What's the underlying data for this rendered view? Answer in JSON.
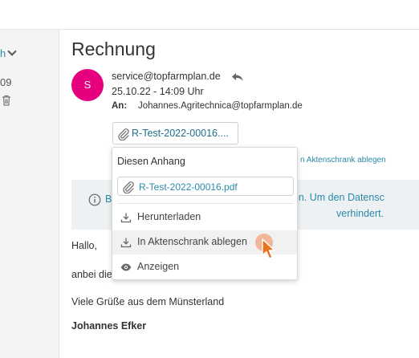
{
  "left_pane": {
    "sort_label": "h",
    "date_fragment": "09"
  },
  "email": {
    "subject": "Rechnung",
    "avatar_initial": "S",
    "sender": "service@topfarmplan.de",
    "date": "25.10.22 - 14:09 Uhr",
    "to_label": "An:",
    "to_value": "Johannes.Agritechnica@topfarmplan.de",
    "attachment_button_label": "R-Test-2022-00016....",
    "aktenschrank_link": "n Aktenschrank ablegen",
    "info_banner": {
      "fragment_b": "B",
      "line1": "zuladen. Um den Datensc",
      "line2": "verhindert."
    },
    "body": {
      "greeting": "Hallo,",
      "line2": "anbei die",
      "closing": "Viele Grüße aus dem Münsterland",
      "signature": "Johannes Efker"
    }
  },
  "attachment_popup": {
    "heading": "Diesen Anhang",
    "filename": "R-Test-2022-00016.pdf",
    "items": [
      {
        "label": "Herunterladen",
        "icon": "download-icon"
      },
      {
        "label": "In Aktenschrank ablegen",
        "icon": "download-icon"
      },
      {
        "label": "Anzeigen",
        "icon": "eye-icon"
      }
    ]
  },
  "colors": {
    "avatar": "#e6007e",
    "link": "#2a8aa8",
    "cursor": "#e8731e"
  }
}
